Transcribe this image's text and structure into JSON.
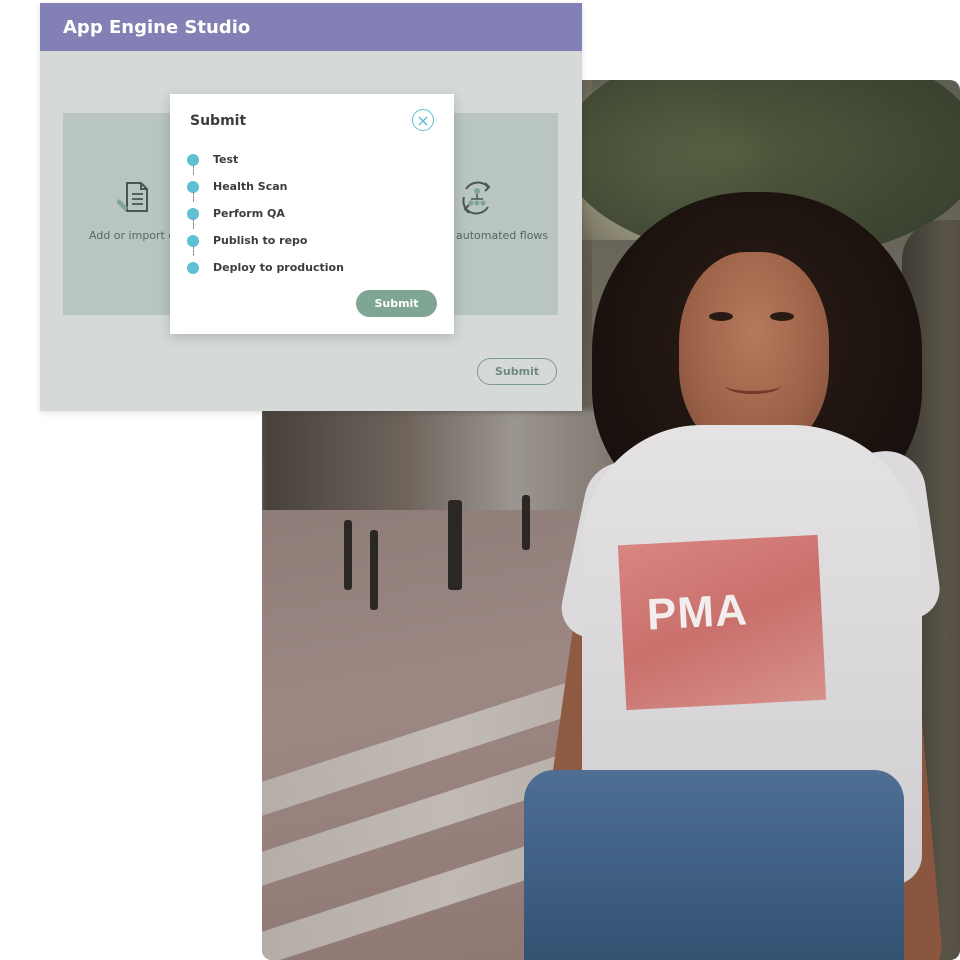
{
  "app": {
    "title": "App Engine Studio",
    "submit_label": "Submit",
    "cards": [
      {
        "label": "Add or import c",
        "icon": "document-edit-icon"
      },
      {
        "label": "automated flows",
        "icon": "workflow-cycle-icon"
      }
    ]
  },
  "modal": {
    "title": "Submit",
    "close_icon": "close-icon",
    "steps": [
      {
        "label": "Test"
      },
      {
        "label": "Health Scan"
      },
      {
        "label": "Perform QA"
      },
      {
        "label": "Publish to repo"
      },
      {
        "label": "Deploy to production"
      }
    ],
    "submit_label": "Submit"
  },
  "photo": {
    "shirt_print_text": "PMA"
  },
  "colors": {
    "header": "#8380b5",
    "accent": "#5fbfd3",
    "submit_fill": "#7fa594",
    "panel_bg": "#d5dad9",
    "card_bg": "#b9c5c0"
  }
}
